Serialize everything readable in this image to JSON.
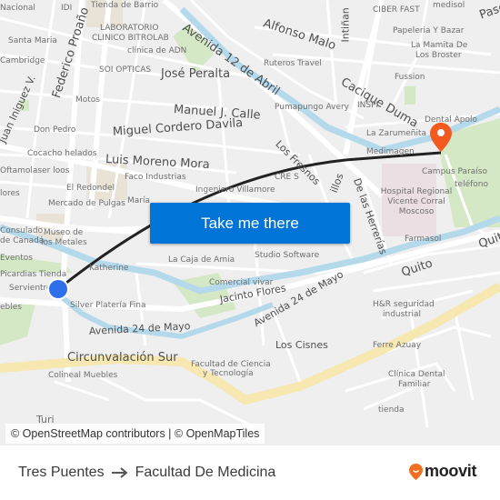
{
  "map": {
    "action_button": "Take me there",
    "attribution": "© OpenStreetMap contributors | © OpenMapTiles",
    "origin_marker_color": "#2f6fea",
    "destination_marker_color": "#f25a1e",
    "route_line_color": "#222222",
    "street_labels": {
      "avenida_12_de_abril": "Avenida 12 de Abril",
      "alfonso_malo": "Alfonso Malo",
      "intinan": "Intiñan",
      "cacique_duma": "Cacique Duma",
      "federico_proano": "Federico Proaño",
      "juan_iniguez": "Juan Iniguez V.",
      "jose_peralta": "José Peralta",
      "manuel_j_calle": "Manuel J. Calle",
      "miguel_cordero_davila": "Miguel Cordero Davila",
      "luis_moreno_mora": "Luis Moreno Mora",
      "los_fresnos": "Los Fresnos",
      "de_las_herrerias": "De las Herrerías",
      "los_olivos_partial": "illos",
      "quito_1": "Quito",
      "quito_2": "Quito",
      "jacinto_flores": "Jacinto Flores",
      "avenida_24_de_mayo_1": "Avenida 24 de Mayo",
      "avenida_24_de_mayo_2": "Avenida 24 de Mayo",
      "los_cisnes": "Los Cisnes",
      "circunvalacion_sur": "Circunvalación Sur",
      "paseo_partial": "Pase"
    },
    "poi_labels": {
      "salud_nacional": "Nacional",
      "idi": "IDI",
      "tienda_de_barrio": "Tienda de Barrio",
      "laboratorio_1": "LABORATORIO",
      "laboratorio_2": "CLINICO BITROLAB",
      "clinica_adn": "clínica de ADN",
      "santa_maria": "Santa Maria",
      "cambridge": "Cambridge",
      "soi_opticas": "SOI OPTICAS",
      "motos": "Motos",
      "ruteros_travel": "Ruteros Travel",
      "pumapungo_avery": "Pumapungo Avery",
      "ciber_fast": "CIBER FAST",
      "medisol": "medisol",
      "papeleria": "Papeleria Y Bazar",
      "mamita_1": "La Mamita De",
      "mamita_2": "Los Broster",
      "fussion": "Fussion",
      "inspi": "INSPI",
      "don_pedro": "Don Pedro",
      "cocacho": "Cocacho helados",
      "oftamolaser": "Oftamolaser loos",
      "el_redondel": "El Redondel",
      "mercado_pulgas": "Mercado de Pulgas",
      "maria": "María",
      "faco_industrias": "Faco Industrias",
      "ingeniero_villamore": "Ingeniero Villamore",
      "cre_s": "CRE S",
      "dental_apolo": "Dental Apolo",
      "la_zarumenita": "La Zarumeñita",
      "medimagen": "Medimagen",
      "campus_paraiso": "Campus Paraíso",
      "telefono": "teléfono",
      "hospital_1": "Hospital Regional",
      "hospital_2": "Vicente Corral",
      "hospital_3": "Moscoso",
      "farmasol": "Farmasol",
      "consulado_1": "Consulado",
      "consulado_2": "de Canadá",
      "museo_1": "Museo de",
      "museo_2": "los Metales",
      "eventos": "Eventos",
      "picardias": "Picardias Tienda",
      "servientrega": "Servientrega",
      "katherine": "Katherine",
      "la_caja_de_amia": "La Caja de Amia",
      "studio_software": "Studio Software",
      "comercial_vivar": "Comercial vivar",
      "silver_plateria": "Silver Platería Fina",
      "muebles": "ebles",
      "hr_1": "H&R seguridad",
      "hr_2": "industrial",
      "ferre_azuay": "Ferre Azuay",
      "colineal": "Colineal Muebles",
      "facultad_1": "Facultad de Ciencia",
      "facultad_2": "y Tecnología",
      "clinica_dental_1": "Clínica Dental",
      "clinica_dental_2": "Familiar",
      "tienda": "tienda",
      "turi": "Turi",
      "flores": "lores"
    }
  },
  "footer": {
    "origin": "Tres Puentes",
    "destination": "Facultad De Medicina",
    "brand": "moovit",
    "brand_color": "#f26f21"
  }
}
